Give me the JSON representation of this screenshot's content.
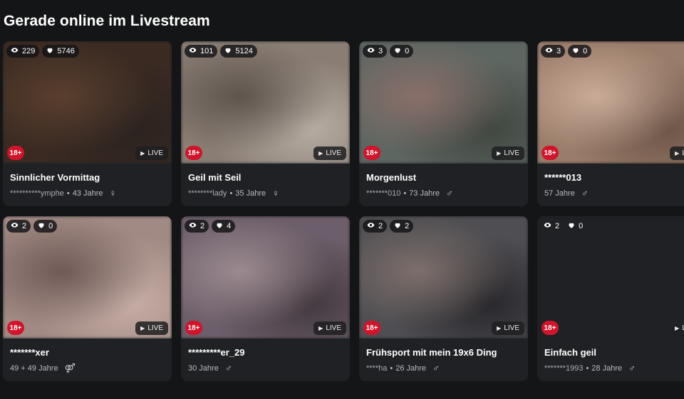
{
  "section": {
    "title": "Gerade online im Livestream"
  },
  "badge_age": "18+",
  "badge_live": "LIVE",
  "cards": [
    {
      "viewers": "229",
      "likes": "5746",
      "title": "Sinnlicher Vormittag",
      "user": "**********ymphe",
      "sep": "•",
      "age": "43 Jahre",
      "gender": "♀",
      "bg": [
        "#3a2a22",
        "#5a3f2e",
        "#2b2320"
      ]
    },
    {
      "viewers": "101",
      "likes": "5124",
      "title": "Geil mit Seil",
      "user": "********lady",
      "sep": "•",
      "age": "35 Jahre",
      "gender": "♀",
      "bg": [
        "#8a7e74",
        "#5e544d",
        "#b7aea4"
      ]
    },
    {
      "viewers": "3",
      "likes": "0",
      "title": "Morgenlust",
      "user": "*******010",
      "sep": "•",
      "age": "73 Jahre",
      "gender": "♂",
      "bg": [
        "#5e6661",
        "#8a6f6a",
        "#3f4640"
      ]
    },
    {
      "viewers": "3",
      "likes": "0",
      "title": "******013",
      "user": "",
      "sep": "",
      "age": "57 Jahre",
      "gender": "♂",
      "bg": [
        "#9a7c6a",
        "#c9ab98",
        "#6b5447"
      ]
    },
    {
      "viewers": "2",
      "likes": "0",
      "title": "*******xer",
      "user": "",
      "sep": "",
      "age": "49 + 49 Jahre",
      "gender": "⚤",
      "bg": [
        "#a28a84",
        "#6f5a56",
        "#c6aea6"
      ]
    },
    {
      "viewers": "2",
      "likes": "4",
      "title": "*********er_29",
      "user": "",
      "sep": "",
      "age": "30 Jahre",
      "gender": "♂",
      "bg": [
        "#6c5e6a",
        "#9b8a8f",
        "#43383f"
      ]
    },
    {
      "viewers": "2",
      "likes": "2",
      "title": "Frühsport mit mein 19x6 Ding",
      "user": "****ha",
      "sep": "•",
      "age": "26 Jahre",
      "gender": "♂",
      "bg": [
        "#4f4e52",
        "#7d6f6b",
        "#27262a"
      ]
    },
    {
      "viewers": "2",
      "likes": "0",
      "title": "Einfach geil",
      "user": "*******1993",
      "sep": "•",
      "age": "28 Jahre",
      "gender": "♂",
      "bg": [
        "#1f2124",
        "#1f2124",
        "#1f2124"
      ]
    }
  ]
}
